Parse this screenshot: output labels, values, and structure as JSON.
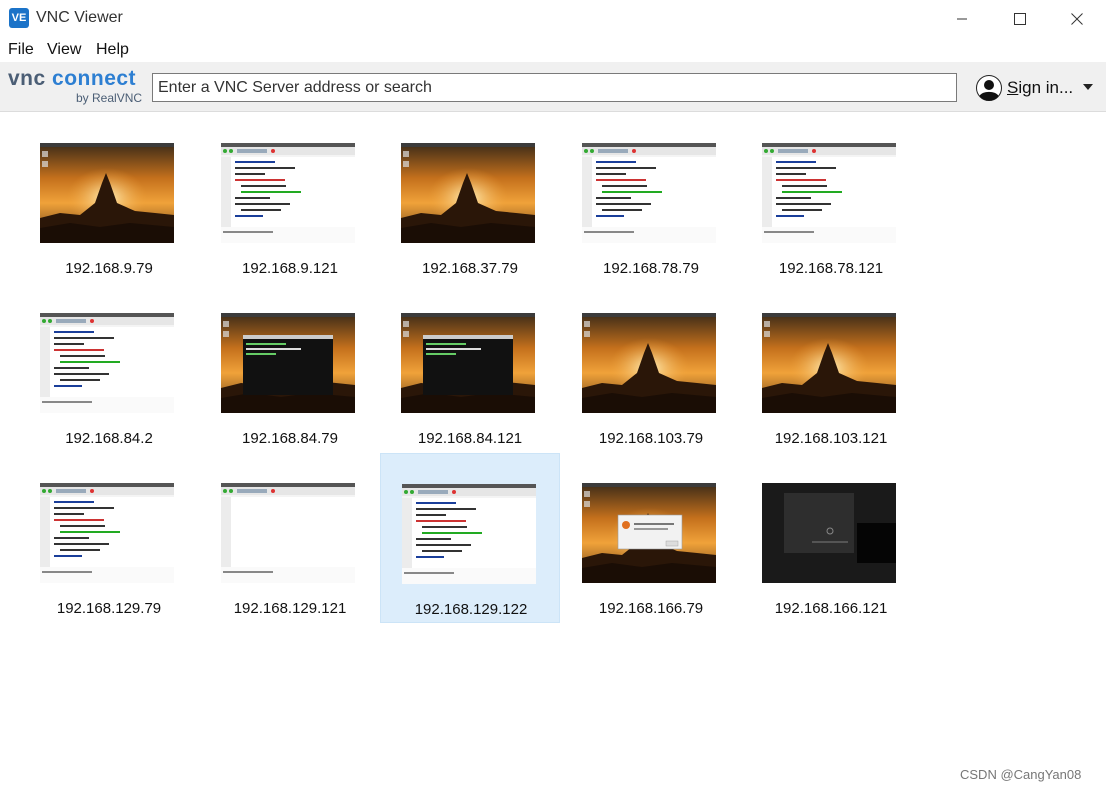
{
  "window": {
    "title": "VNC Viewer",
    "app_icon_label": "VE"
  },
  "menu": [
    "File",
    "View",
    "Help"
  ],
  "toolbar": {
    "logo_main_a": "vnc",
    "logo_main_b": "connect",
    "logo_sub": "by RealVNC",
    "search_placeholder": "Enter a VNC Server address or search",
    "signin_first": "S",
    "signin_rest": "ign in..."
  },
  "connections": [
    {
      "address": "192.168.9.79",
      "thumb": "sunset",
      "selected": false
    },
    {
      "address": "192.168.9.121",
      "thumb": "editor",
      "selected": false
    },
    {
      "address": "192.168.37.79",
      "thumb": "sunset",
      "selected": false
    },
    {
      "address": "192.168.78.79",
      "thumb": "editor",
      "selected": false
    },
    {
      "address": "192.168.78.121",
      "thumb": "editor",
      "selected": false
    },
    {
      "address": "192.168.84.2",
      "thumb": "editor",
      "selected": false
    },
    {
      "address": "192.168.84.79",
      "thumb": "sunset-terminal",
      "selected": false
    },
    {
      "address": "192.168.84.121",
      "thumb": "sunset-terminal",
      "selected": false
    },
    {
      "address": "192.168.103.79",
      "thumb": "sunset",
      "selected": false
    },
    {
      "address": "192.168.103.121",
      "thumb": "sunset",
      "selected": false
    },
    {
      "address": "192.168.129.79",
      "thumb": "editor",
      "selected": false
    },
    {
      "address": "192.168.129.121",
      "thumb": "editor-blank",
      "selected": false
    },
    {
      "address": "192.168.129.122",
      "thumb": "editor",
      "selected": true
    },
    {
      "address": "192.168.166.79",
      "thumb": "sunset-dialog",
      "selected": false
    },
    {
      "address": "192.168.166.121",
      "thumb": "dark",
      "selected": false
    }
  ],
  "watermark": "CSDN @CangYan08",
  "colors": {
    "accent": "#2d7fd2",
    "selection": "#dcedfb",
    "toolbar_bg": "#f0f0f0"
  }
}
